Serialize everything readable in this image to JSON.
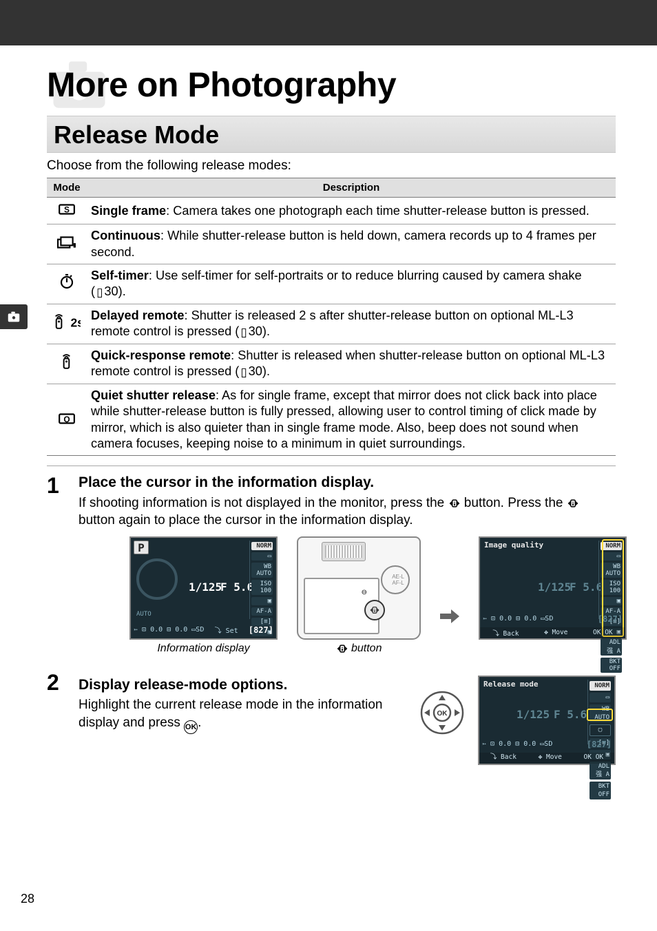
{
  "chapter_title": "More on Photography",
  "section_title": "Release Mode",
  "intro": "Choose from the following release modes:",
  "table": {
    "head_mode": "Mode",
    "head_desc": "Description",
    "rows": [
      {
        "name": "Single frame",
        "desc": ": Camera takes one photograph each time shutter-release button is pressed."
      },
      {
        "name": "Continuous",
        "desc": ": While shutter-release button is held down, camera records up to 4 frames per second."
      },
      {
        "name": "Self-timer",
        "desc_a": ": Use self-timer for self-portraits or to reduce blurring caused by camera shake (",
        "page_ref": "30",
        "desc_b": ")."
      },
      {
        "name": "Delayed remote",
        "desc_a": ": Shutter is released 2 s after shutter-release button on optional ML-L3 remote control is pressed (",
        "page_ref": "30",
        "desc_b": ")."
      },
      {
        "name": "Quick-response remote",
        "desc_a": ": Shutter is released when shutter-release button on optional ML-L3 remote control is pressed (",
        "page_ref": "30",
        "desc_b": ")."
      },
      {
        "name": "Quiet shutter release",
        "desc": ": As for single frame, except that mirror does not click back into place while shutter-release button is fully pressed, allowing user to control timing of click made by mirror, which is also quieter than in single frame mode.  Also, beep does not sound when camera focuses, keeping noise to a minimum in quiet surroundings."
      }
    ]
  },
  "steps": [
    {
      "num": "1",
      "heading": "Place the cursor in the information display.",
      "body_a": "If shooting information is not displayed in the monitor, press the ",
      "body_b": " button. Press the ",
      "body_c": " button again to place the cursor in the information display.",
      "fig1_caption": "Information display",
      "fig2_caption": " button"
    },
    {
      "num": "2",
      "heading": "Display release-mode options.",
      "body_a": "Highlight the current release mode in the information display and press ",
      "body_b": "."
    }
  ],
  "lcd": {
    "mode_glyph": "P",
    "shutter": "1/125",
    "fnumber": "F 5.6",
    "autolabel": "AUTO",
    "right_col": [
      "NORM",
      "▭",
      "WB AUTO",
      "ISO 100",
      "▣",
      "AF-A",
      "[≡]",
      "▣",
      "ADL 强 A",
      "BKT OFF"
    ],
    "bottom_left": "➳   ⊡ 0.0 ⊟ 0.0 ▭SD",
    "bottom_set": "⤵ Set",
    "remaining": "[827]",
    "quality_title": "Image quality",
    "release_title": "Release mode",
    "footer_back": "⤵ Back",
    "footer_move": "✥ Move",
    "footer_ok": "OK OK"
  },
  "page_number": "28",
  "chart_data": null
}
